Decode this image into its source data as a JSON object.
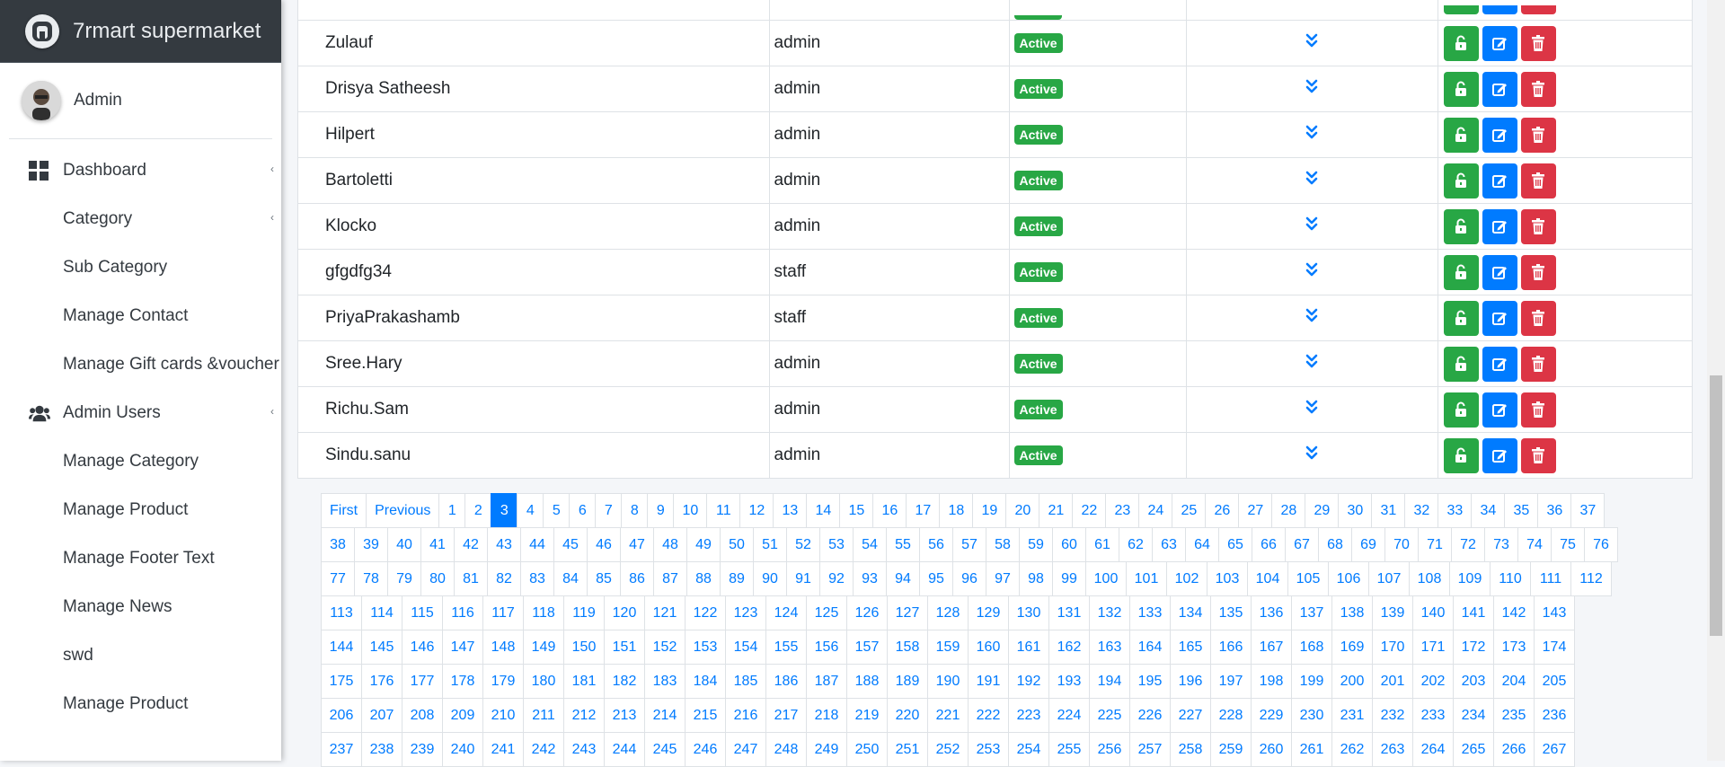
{
  "brand": {
    "title": "7rmart supermarket"
  },
  "user": {
    "name": "Admin"
  },
  "sidebar": {
    "items": [
      {
        "label": "Dashboard"
      },
      {
        "label": "Category"
      },
      {
        "label": "Sub Category"
      },
      {
        "label": "Manage Contact"
      },
      {
        "label": "Manage Gift cards &voucher"
      },
      {
        "label": "Admin Users"
      },
      {
        "label": "Manage Category"
      },
      {
        "label": "Manage Product"
      },
      {
        "label": "Manage Footer Text"
      },
      {
        "label": "Manage News"
      },
      {
        "label": "swd"
      },
      {
        "label": "Manage Product"
      }
    ]
  },
  "table": {
    "status_label": "Active",
    "rows": [
      {
        "name": "Zulauf",
        "role": "admin",
        "status": "Active"
      },
      {
        "name": "Drisya Satheesh",
        "role": "admin",
        "status": "Active"
      },
      {
        "name": "Hilpert",
        "role": "admin",
        "status": "Active"
      },
      {
        "name": "Bartoletti",
        "role": "admin",
        "status": "Active"
      },
      {
        "name": "Klocko",
        "role": "admin",
        "status": "Active"
      },
      {
        "name": "gfgdfg34",
        "role": "staff",
        "status": "Active"
      },
      {
        "name": "PriyaPrakashamb",
        "role": "staff",
        "status": "Active"
      },
      {
        "name": "Sree.Hary",
        "role": "admin",
        "status": "Active"
      },
      {
        "name": "Richu.Sam",
        "role": "admin",
        "status": "Active"
      },
      {
        "name": "Sindu.sanu",
        "role": "admin",
        "status": "Active"
      }
    ]
  },
  "pagination": {
    "first_label": "First",
    "previous_label": "Previous",
    "current_page": 3,
    "rows": [
      [
        1,
        37
      ],
      [
        38,
        76
      ],
      [
        77,
        112
      ],
      [
        113,
        143
      ],
      [
        144,
        174
      ],
      [
        175,
        205
      ],
      [
        206,
        236
      ],
      [
        237,
        267
      ]
    ]
  },
  "colors": {
    "primary": "#007bff",
    "success": "#28a745",
    "danger": "#dc3545",
    "brand_bg": "#343a40"
  },
  "icons": {
    "logo": "brand-logo-icon",
    "dashboard": "grid-icon",
    "admin_users": "users-icon",
    "expand": "double-chevron-down-icon",
    "unlock": "unlock-icon",
    "edit": "edit-icon",
    "delete": "trash-icon"
  }
}
